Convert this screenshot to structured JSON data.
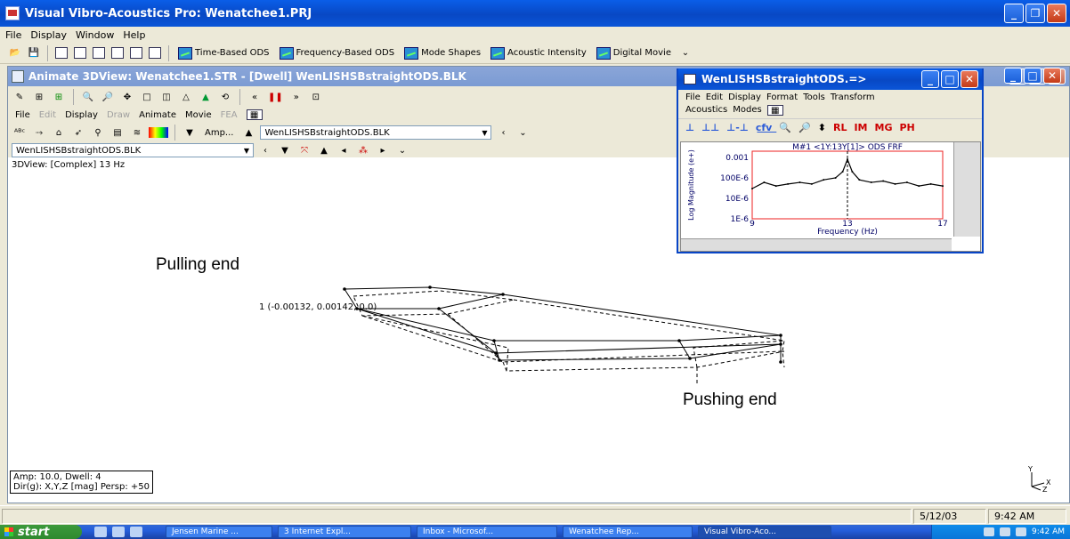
{
  "app": {
    "title": "Visual Vibro-Acoustics Pro: Wenatchee1.PRJ",
    "menu": [
      "File",
      "Display",
      "Window",
      "Help"
    ],
    "toolbar_buttons": [
      "Time-Based ODS",
      "Frequency-Based ODS",
      "Mode Shapes",
      "Acoustic Intensity",
      "Digital Movie"
    ]
  },
  "child": {
    "title": "Animate 3DView: Wenatchee1.STR - [Dwell] WenLISHSBstraightODS.BLK",
    "menu": [
      {
        "label": "File",
        "enabled": true
      },
      {
        "label": "Edit",
        "enabled": false
      },
      {
        "label": "Display",
        "enabled": true
      },
      {
        "label": "Draw",
        "enabled": false
      },
      {
        "label": "Animate",
        "enabled": true
      },
      {
        "label": "Movie",
        "enabled": true
      },
      {
        "label": "FEA",
        "enabled": false
      }
    ],
    "amp_label": "Amp...",
    "block_combo": "WenLISHSBstraightODS.BLK",
    "block_combo2": "WenLISHSBstraightODS.BLK",
    "view_label": "3DView: [Complex] 13 Hz",
    "status_line1": "Amp: 10.0,  Dwell: 4",
    "status_line2": "Dir(g):  X,Y,Z [mag] Persp: +50",
    "annotation_pulling": "Pulling end",
    "annotation_pushing": "Pushing end",
    "point_label": "1 (-0.00132, 0.00142, 0.0)",
    "axis_labels": {
      "y": "Y",
      "x": "X",
      "z": "Z"
    }
  },
  "frf": {
    "title": "WenLISHSBstraightODS.=>",
    "menu1": [
      "File",
      "Edit",
      "Display",
      "Format",
      "Tools",
      "Transform"
    ],
    "menu2": [
      "Acoustics",
      "Modes"
    ],
    "tools": [
      "RL",
      "IM",
      "MG",
      "PH"
    ],
    "plot_title": "M#1 <1Y:13Y[1]> ODS FRF"
  },
  "chart_data": {
    "type": "line",
    "title": "M#1 <1Y:13Y[1]> ODS FRF",
    "xlabel": "Frequency (Hz)",
    "ylabel": "Log Magnitude (e+)",
    "yscale": "log",
    "xlim": [
      9,
      17
    ],
    "x_ticks": [
      9,
      13,
      17
    ],
    "y_ticks": [
      "0.001",
      "100E-6",
      "10E-6",
      "1E-6"
    ],
    "cursor_x": 13,
    "series": [
      {
        "x": [
          9.0,
          9.5,
          10.0,
          10.5,
          11.0,
          11.5,
          12.0,
          12.5,
          12.8,
          13.0,
          13.2,
          13.5,
          14.0,
          14.5,
          15.0,
          15.5,
          16.0,
          16.5,
          17.0
        ],
        "y": [
          3e-05,
          6e-05,
          4e-05,
          5e-05,
          6e-05,
          5e-05,
          8e-05,
          0.0001,
          0.0002,
          0.0008,
          0.0002,
          8e-05,
          6e-05,
          7e-05,
          5e-05,
          6e-05,
          4e-05,
          5e-05,
          4e-05
        ]
      }
    ],
    "grid": false
  },
  "statusbar": {
    "date": "5/12/03",
    "time": "9:42 AM"
  },
  "taskbar": {
    "start": "start",
    "tasks": [
      "Jensen Marine ...",
      "3 Internet Expl...",
      "Inbox - Microsof...",
      "Wenatchee Rep...",
      "Visual Vibro-Aco..."
    ],
    "clock": "9:42 AM"
  }
}
